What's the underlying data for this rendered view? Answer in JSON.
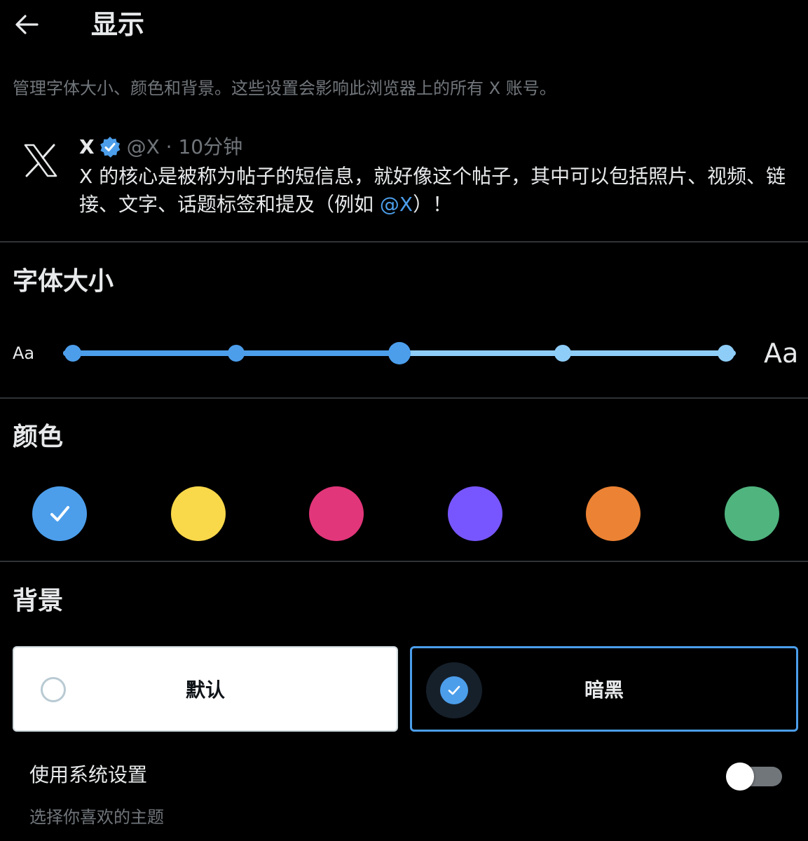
{
  "header": {
    "title": "显示",
    "back_icon": "arrow-left-icon"
  },
  "description": "管理字体大小、颜色和背景。这些设置会影响此浏览器上的所有 X 账号。",
  "preview_post": {
    "name": "X",
    "handle_time": "@X · 10分钟",
    "body_text": "X 的核心是被称为帖子的短信息，就好像这个帖子，其中可以包括照片、视频、链接、文字、话题标签和提及（例如 ",
    "mention": "@X",
    "body_end": "）！"
  },
  "font_size": {
    "title": "字体大小",
    "small_label": "Aa",
    "large_label": "Aa",
    "stops": 5,
    "selected_index": 2
  },
  "colors": {
    "title": "颜色",
    "swatches": [
      {
        "name": "blue",
        "hex": "#4c9eeb",
        "selected": true
      },
      {
        "name": "yellow",
        "hex": "#f9d84a",
        "selected": false
      },
      {
        "name": "pink",
        "hex": "#e2367a",
        "selected": false
      },
      {
        "name": "purple",
        "hex": "#7856ff",
        "selected": false
      },
      {
        "name": "orange",
        "hex": "#ec8234",
        "selected": false
      },
      {
        "name": "green",
        "hex": "#4fb47e",
        "selected": false
      }
    ]
  },
  "background": {
    "title": "背景",
    "options": [
      {
        "label": "默认",
        "selected": false
      },
      {
        "label": "暗黑",
        "selected": true
      }
    ]
  },
  "system_setting": {
    "label": "使用系统设置",
    "subtitle": "选择你喜欢的主题",
    "enabled": false
  },
  "theme": {
    "accent": "#4c9eeb",
    "accent_light": "#8ecdf8",
    "muted_text": "#71767b",
    "divider": "#2f3336"
  }
}
